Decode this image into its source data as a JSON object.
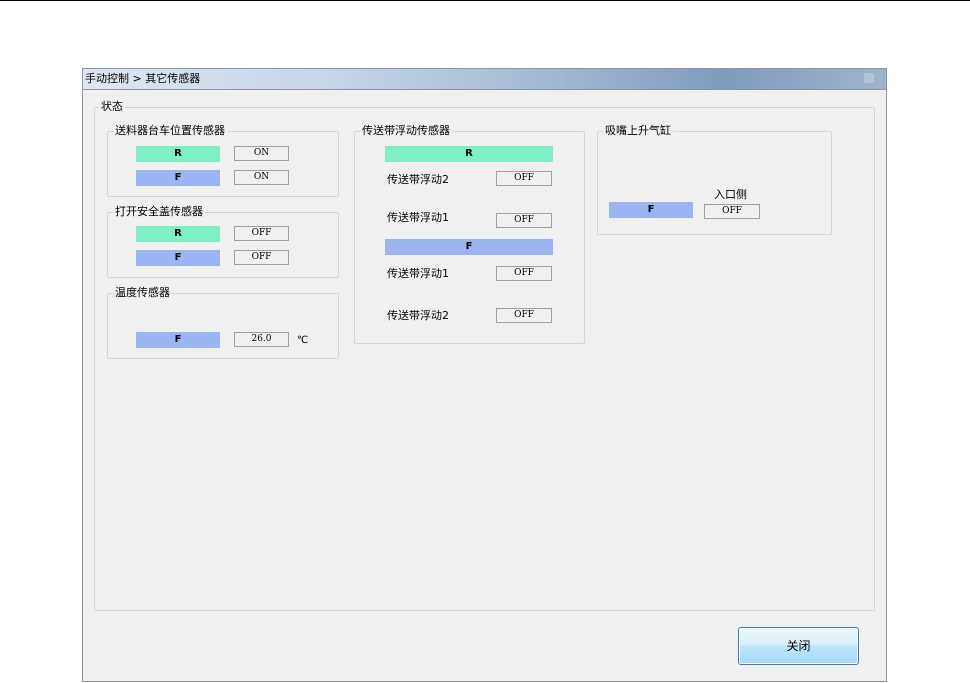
{
  "window": {
    "title": "手动控制 > 其它传感器"
  },
  "status_group": {
    "label": "状态"
  },
  "feeder_group": {
    "label": "送料器台车位置传感器",
    "rows": [
      {
        "indicator": "R",
        "value": "ON"
      },
      {
        "indicator": "F",
        "value": "ON"
      }
    ]
  },
  "safety_group": {
    "label": "打开安全盖传感器",
    "rows": [
      {
        "indicator": "R",
        "value": "OFF"
      },
      {
        "indicator": "F",
        "value": "OFF"
      }
    ]
  },
  "temp_group": {
    "label": "温度传感器",
    "indicator": "F",
    "value": "26.0",
    "unit": "℃"
  },
  "conveyor_group": {
    "label": "传送带浮动传感器",
    "r_section": {
      "header": "R",
      "rows": [
        {
          "label": "传送带浮动2",
          "value": "OFF"
        },
        {
          "label": "传送带浮动1",
          "value": "OFF"
        }
      ]
    },
    "f_section": {
      "header": "F",
      "rows": [
        {
          "label": "传送带浮动1",
          "value": "OFF"
        },
        {
          "label": "传送带浮动2",
          "value": "OFF"
        }
      ]
    }
  },
  "nozzle_group": {
    "label": "吸嘴上升气缸",
    "column_header": "入口侧",
    "indicator": "F",
    "value": "OFF"
  },
  "buttons": {
    "close": "关闭"
  },
  "colors": {
    "indicator_r": "#7ff0c5",
    "indicator_f": "#9db4f2"
  }
}
